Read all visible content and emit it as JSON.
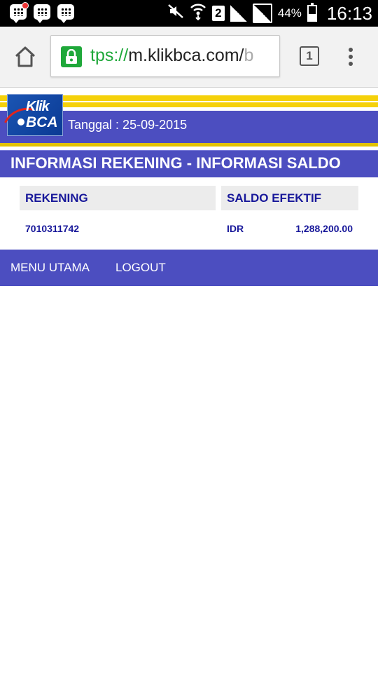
{
  "status_bar": {
    "battery": "44%",
    "time": "16:13",
    "sim": "2"
  },
  "browser": {
    "url_scheme": "tps://",
    "url_host": "m.klikbca.com/",
    "url_rest": "b",
    "tabs_count": "1"
  },
  "header": {
    "logo_top": "Klik",
    "logo_bottom": "BCA",
    "tanggal": "Tanggal : 25-09-2015"
  },
  "page": {
    "title": "INFORMASI REKENING - INFORMASI SALDO"
  },
  "table": {
    "headers": [
      "REKENING",
      "SALDO EFEKTIF"
    ],
    "rows": [
      {
        "rekening": "7010311742",
        "currency": "IDR",
        "saldo": "1,288,200.00"
      }
    ]
  },
  "nav": {
    "menu_utama": "MENU UTAMA",
    "logout": "LOGOUT"
  }
}
